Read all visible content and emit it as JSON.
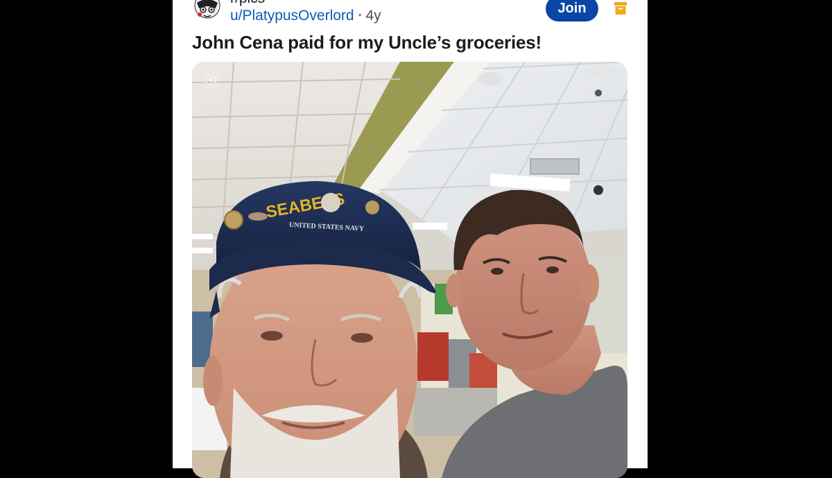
{
  "post": {
    "subreddit": "r/pics",
    "username": "u/PlatypusOverlord",
    "age": "4y",
    "join_label": "Join",
    "title": "John Cena paid for my Uncle’s groceries!"
  },
  "photo": {
    "hat_text": "SEABEES",
    "hat_subtext": "UNITED STATES NAVY"
  },
  "colors": {
    "join_bg": "#0a46a6",
    "username": "#0e5ab5",
    "save_icon": "#f0a81c",
    "page_bg": "#000000"
  },
  "icons": [
    "subreddit-avatar-icon",
    "save-icon",
    "live-photo-icon"
  ]
}
